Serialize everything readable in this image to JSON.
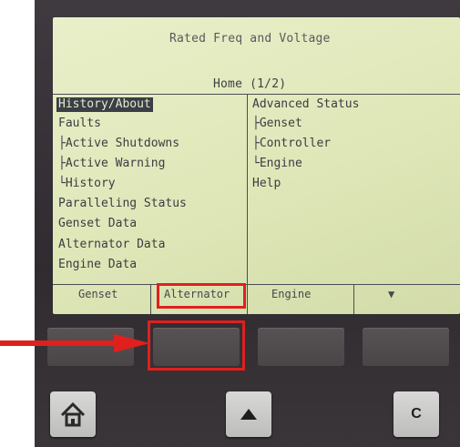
{
  "screen": {
    "title": "Rated Freq and Voltage",
    "home": "Home (1/2)",
    "left_menu": [
      "History/About",
      "Faults",
      "├Active Shutdowns",
      "├Active Warning",
      "└History",
      "Paralleling Status",
      "Genset Data",
      "Alternator Data",
      "Engine Data"
    ],
    "right_menu": [
      "Advanced Status",
      "├Genset",
      "├Controller",
      "└Engine",
      "Help"
    ]
  },
  "softkeys": [
    "Genset",
    "Alternator",
    "Engine",
    "▼"
  ],
  "nav_buttons": {
    "home_icon": "home-icon",
    "up_icon": "triangle-up-icon",
    "clear_label": "C"
  },
  "annotation": {
    "highlight_color": "#e0201e",
    "arrow_color": "#e0201e"
  }
}
